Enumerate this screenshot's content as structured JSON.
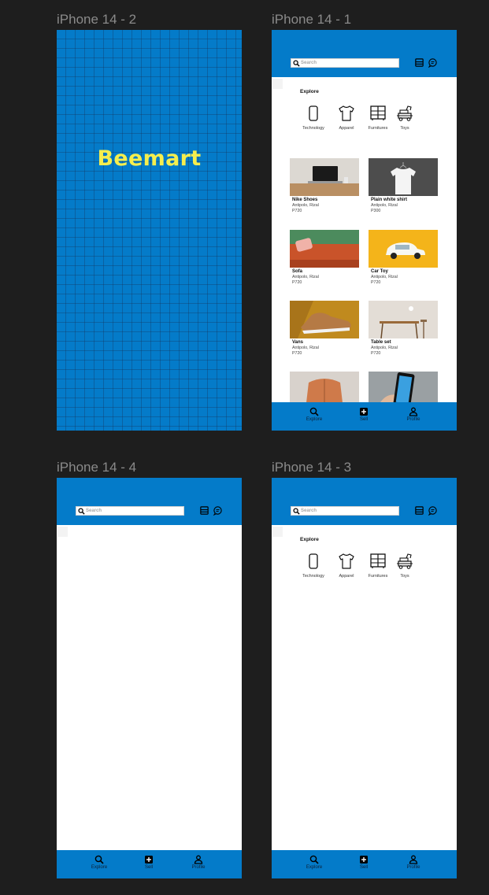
{
  "frames": {
    "splash": {
      "label": "iPhone 14 - 2",
      "logo": "Beemart"
    },
    "explore_full": {
      "label": "iPhone 14 - 1"
    },
    "blank": {
      "label": "iPhone 14 - 4"
    },
    "explore_empty": {
      "label": "iPhone 14 - 3"
    }
  },
  "search": {
    "placeholder": "Search"
  },
  "explore": {
    "title": "Explore",
    "categories": [
      {
        "label": "Technology",
        "icon": "phone-icon"
      },
      {
        "label": "Apparel",
        "icon": "shirt-icon"
      },
      {
        "label": "Furnitures",
        "icon": "cabinet-icon"
      },
      {
        "label": "Toys",
        "icon": "toy-icon"
      }
    ]
  },
  "products": [
    {
      "name": "Nike Shoes",
      "location": "Antipolo, Rizal",
      "price": "P720",
      "image": "laptop-desk-image"
    },
    {
      "name": "Plain white shirt",
      "location": "Antipolo, Rizal",
      "price": "P300",
      "image": "white-shirt-image"
    },
    {
      "name": "Sofa",
      "location": "Antipolo, Rizal",
      "price": "P720",
      "image": "orange-sofa-image"
    },
    {
      "name": "Car Toy",
      "location": "Antipolo, Rizal",
      "price": "P720",
      "image": "toy-car-image"
    },
    {
      "name": "Vans",
      "location": "Antipolo, Rizal",
      "price": "P720",
      "image": "sneaker-image"
    },
    {
      "name": "Table set",
      "location": "Antipolo, Rizal",
      "price": "P720",
      "image": "table-set-image"
    },
    {
      "image": "orange-jacket-image"
    },
    {
      "image": "smartphone-hand-image"
    }
  ],
  "nav": {
    "explore": "Explore",
    "sell": "Sell",
    "profile": "Profile"
  },
  "colors": {
    "brand_blue": "#047bc9",
    "logo_yellow": "#f5ee4e",
    "canvas": "#1e1e1e"
  }
}
